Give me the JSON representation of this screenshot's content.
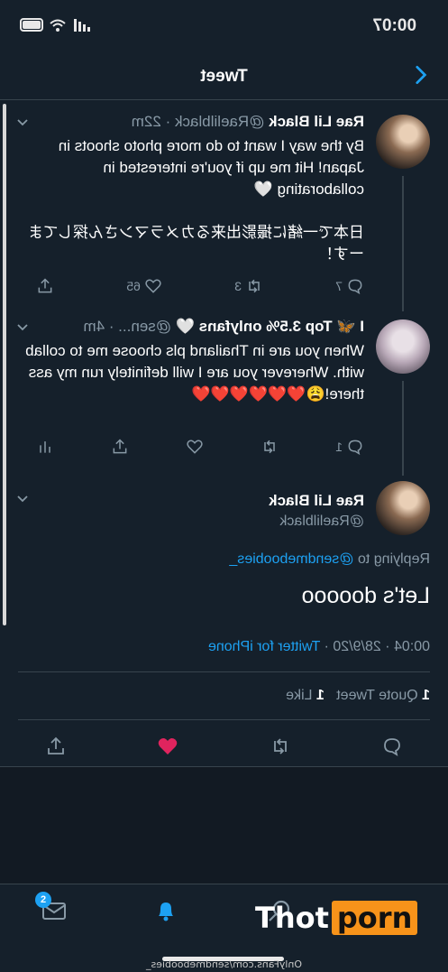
{
  "status_bar": {
    "time": "00:07"
  },
  "header": {
    "title": "Tweet"
  },
  "tweets": [
    {
      "name": "Rae Lil Black",
      "handle": "@Raelilblack",
      "time": "22m",
      "text": "By the way I want to do more photo shoots in Japan! Hit me up if you're interested in collaborating 🤍\n\n日本で一緒に撮影出来るカメラマンさん探してまーす！",
      "replies": "7",
      "retweets": "3",
      "likes": "65"
    },
    {
      "name": "I 🦋 Top 3.5% onlyfans 🤍",
      "handle": "@sen...",
      "time": "4m",
      "text": "When you are in Thailand pls choose me to collab with. Wherever you are I will definitely run my ass there!😩❤️❤️❤️❤️❤️❤️",
      "replies": "1",
      "retweets": "",
      "likes": ""
    }
  ],
  "main_tweet": {
    "name": "Rae Lil Black",
    "handle": "@Raelilblack",
    "replying_prefix": "Replying to",
    "replying_to": "@sendmeboobies_",
    "text": "Let's dooooo",
    "timestamp": "00:04 · 28/9/20 ·",
    "source": "Twitter for iPhone",
    "quote_count": "1",
    "quote_label": "Quote Tweet",
    "like_count": "1",
    "like_label": "Like"
  },
  "tabbar": {
    "messages_badge": "2"
  },
  "caption": "OnlyFans.com/sendmeboobies_",
  "watermark": {
    "part1": "Thot",
    "part2": "porn"
  },
  "colors": {
    "background": "#15202b",
    "accent": "#1da1f2",
    "like": "#e0245e",
    "muted": "#8899a6"
  }
}
